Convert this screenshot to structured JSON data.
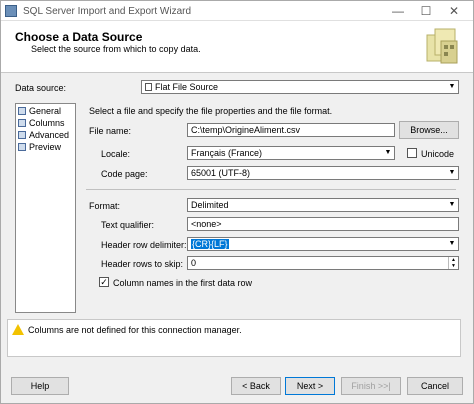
{
  "window": {
    "title": "SQL Server Import and Export Wizard",
    "minimize": "—",
    "maximize": "☐",
    "close": "✕"
  },
  "header": {
    "title": "Choose a Data Source",
    "subtitle": "Select the source from which to copy data."
  },
  "data_source": {
    "label": "Data source:",
    "value": "Flat File Source"
  },
  "nav": {
    "items": [
      "General",
      "Columns",
      "Advanced",
      "Preview"
    ]
  },
  "general": {
    "instructions": "Select a file and specify the file properties and the file format.",
    "file_name_label": "File name:",
    "file_name_value": "C:\\temp\\OrigineAliment.csv",
    "browse_label": "Browse...",
    "locale_label": "Locale:",
    "locale_value": "Français (France)",
    "unicode_label": "Unicode",
    "code_page_label": "Code page:",
    "code_page_value": "65001 (UTF-8)",
    "format_label": "Format:",
    "format_value": "Delimited",
    "text_qualifier_label": "Text qualifier:",
    "text_qualifier_value": "<none>",
    "header_row_delimiter_label": "Header row delimiter:",
    "header_row_delimiter_value": "{CR}{LF}",
    "header_rows_skip_label": "Header rows to skip:",
    "header_rows_skip_value": "0",
    "column_names_label": "Column names in the first data row"
  },
  "warning": {
    "text": "Columns are not defined for this connection manager."
  },
  "footer": {
    "help": "Help",
    "back": "< Back",
    "next": "Next >",
    "finish": "Finish >>|",
    "cancel": "Cancel"
  }
}
